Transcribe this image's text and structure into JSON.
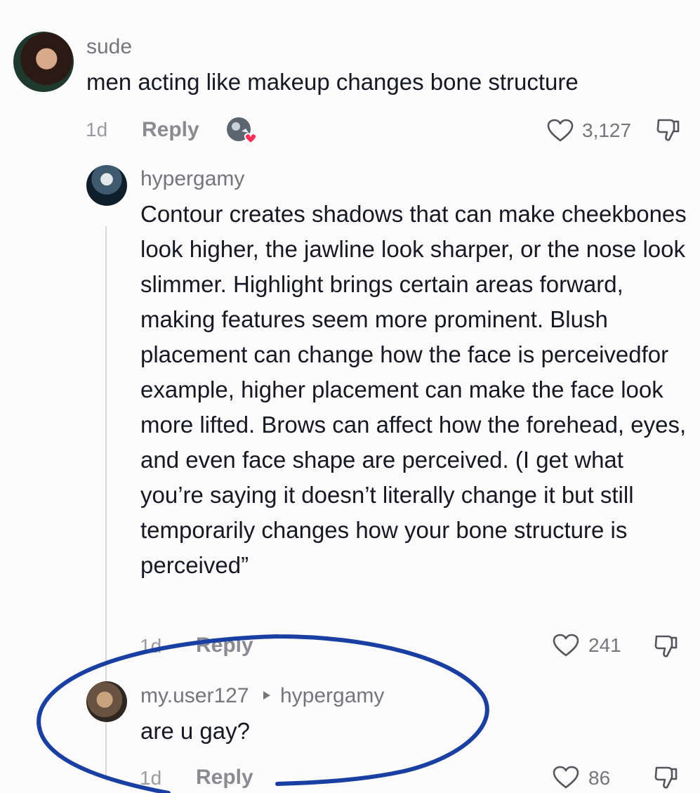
{
  "comments": [
    {
      "username": "sude",
      "text": "men acting like makeup changes bone structure",
      "age": "1d",
      "reply_label": "Reply",
      "likes": "3,127"
    },
    {
      "username": "hypergamy",
      "text": "Contour creates shadows that can make cheekbones look higher, the jawline look sharper, or the nose look slimmer. Highlight brings certain areas forward, making features seem more prominent. Blush placement can change how the face is perceivedfor example, higher placement can make the face look more lifted. Brows can affect how the forehead, eyes, and even face shape are perceived. (I get what you’re saying it doesn’t literally change it but still temporarily changes how your bone structure is perceived”",
      "age": "1d",
      "reply_label": "Reply",
      "likes": "241"
    },
    {
      "username": "my.user127",
      "reply_to": "hypergamy",
      "text": "are u gay?",
      "age": "1d",
      "reply_label": "Reply",
      "likes": "86"
    }
  ],
  "colors": {
    "background": "#fbfbfb",
    "text": "#161823",
    "muted": "#75767c",
    "like_badge": "#fe2c55",
    "annotation": "#1a3fa3"
  },
  "icons": [
    "heart-outline-icon",
    "dislike-icon",
    "play-triangle-icon",
    "creator-liked-badge"
  ]
}
